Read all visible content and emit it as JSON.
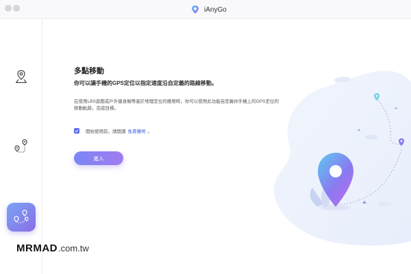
{
  "window": {
    "app_name": "iAnyGo"
  },
  "sidebar": {
    "items": [
      {
        "name": "single-point-location",
        "icon": "location-pin-icon",
        "active": false
      },
      {
        "name": "two-spot-movement",
        "icon": "route-two-pins-icon",
        "active": false
      },
      {
        "name": "multi-spot-movement",
        "icon": "multi-pin-route-icon",
        "active": true
      }
    ]
  },
  "main": {
    "title": "多點移動",
    "subtitle": "你可以讓手機的GPS定位以指定速度沿自定義的路線移動。",
    "description": "在使用LBS遊戲或戶外健身類等基於地理定位的應用時，你可以使用此功能自定義你手機上的GPS定位的移動軌跡，完成目標。",
    "agree": {
      "checked": true,
      "prefix": "開始使用前，請閱讀",
      "link": "免責聲明",
      "suffix": "。"
    },
    "enter_button": "進入"
  },
  "watermark": {
    "bold": "MRMAD",
    "light": ".com.tw"
  },
  "colors": {
    "accent": "#5b6cf0",
    "button_gradient_start": "#7b86f4",
    "button_gradient_end": "#a07cf0",
    "link": "#3b5fe0"
  }
}
